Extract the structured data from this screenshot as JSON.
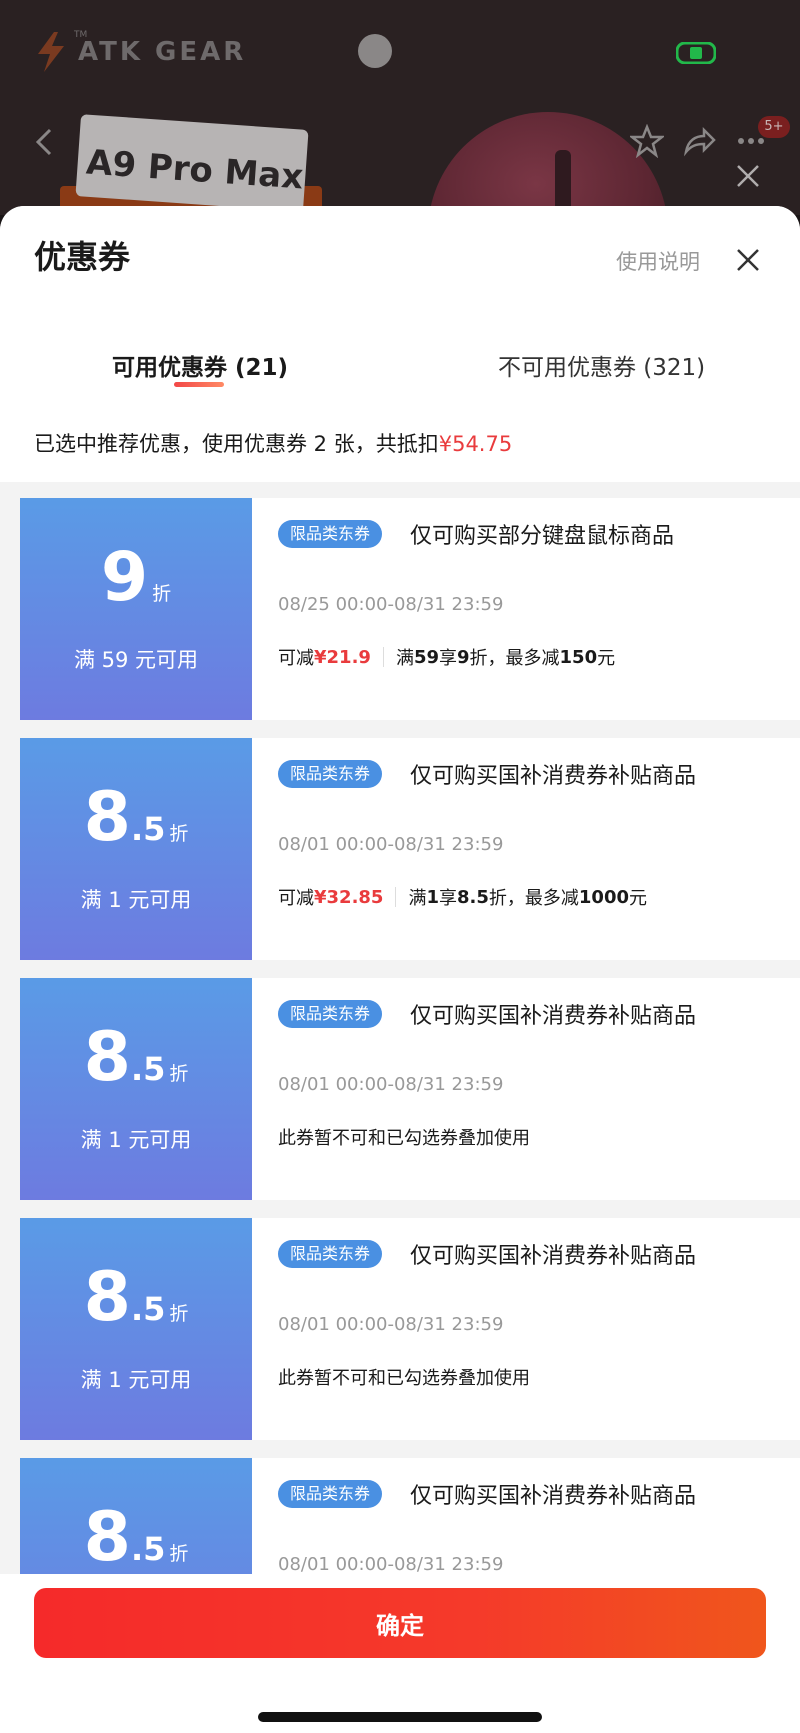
{
  "background": {
    "brand": "ATK GEAR",
    "trademark": "TM",
    "product_card": "A9 Pro Max",
    "cart_badge": "5+"
  },
  "sheet": {
    "title": "优惠券",
    "help_link": "使用说明",
    "tabs": [
      {
        "label": "可用优惠券 (21)",
        "active": true
      },
      {
        "label": "不可用优惠券 (321)",
        "active": false
      }
    ],
    "summary_prefix": "已选中推荐优惠，使用优惠券 2 张，共抵扣",
    "summary_amount": "¥54.75"
  },
  "coupons": [
    {
      "integer": "9",
      "decimal": "",
      "unit": "折",
      "threshold": "满 59 元可用",
      "tag": "限品类东券",
      "title": "仅可购买部分键盘鼠标商品",
      "date": "08/25 00:00-08/31 23:59",
      "saving_label": "可减",
      "saving_amount": "¥21.9",
      "rule_1": "满",
      "rule_1b": "59",
      "rule_2": "享",
      "rule_2b": "9",
      "rule_3": "折，最多减",
      "rule_3b": "150",
      "rule_4": "元",
      "note": "",
      "selected": true
    },
    {
      "integer": "8",
      "decimal": ".5",
      "unit": "折",
      "threshold": "满 1 元可用",
      "tag": "限品类东券",
      "title": "仅可购买国补消费券补贴商品",
      "date": "08/01 00:00-08/31 23:59",
      "saving_label": "可减",
      "saving_amount": "¥32.85",
      "rule_1": "满",
      "rule_1b": "1",
      "rule_2": "享",
      "rule_2b": "8.5",
      "rule_3": "折，最多减",
      "rule_3b": "1000",
      "rule_4": "元",
      "note": "",
      "selected": true
    },
    {
      "integer": "8",
      "decimal": ".5",
      "unit": "折",
      "threshold": "满 1 元可用",
      "tag": "限品类东券",
      "title": "仅可购买国补消费券补贴商品",
      "date": "08/01 00:00-08/31 23:59",
      "note": "此券暂不可和已勾选券叠加使用",
      "selected": false
    },
    {
      "integer": "8",
      "decimal": ".5",
      "unit": "折",
      "threshold": "满 1 元可用",
      "tag": "限品类东券",
      "title": "仅可购买国补消费券补贴商品",
      "date": "08/01 00:00-08/31 23:59",
      "note": "此券暂不可和已勾选券叠加使用",
      "selected": false
    },
    {
      "integer": "8",
      "decimal": ".5",
      "unit": "折",
      "threshold": "",
      "tag": "限品类东券",
      "title": "仅可购买国补消费券补贴商品",
      "date": "08/01 00:00-08/31 23:59",
      "note": "",
      "selected": false
    }
  ],
  "confirm_label": "确定",
  "colors": {
    "accent_red": "#e93b3d",
    "coupon_blue": "#5a9be6",
    "tag_blue": "#4a90e2"
  }
}
